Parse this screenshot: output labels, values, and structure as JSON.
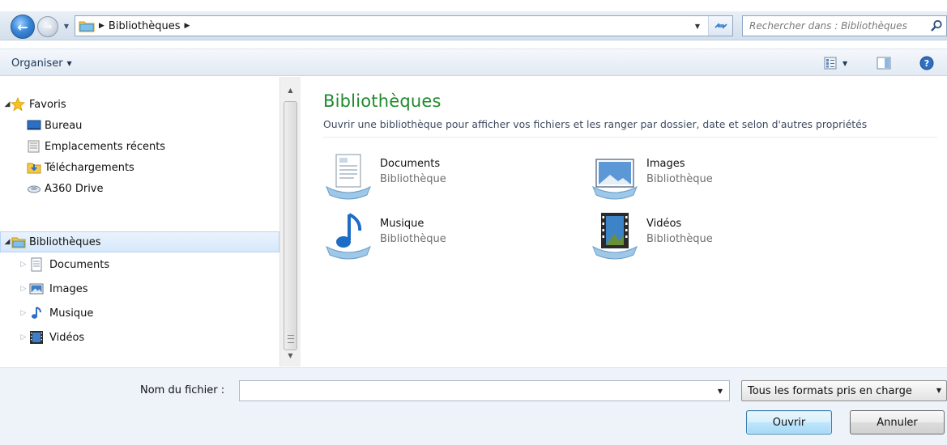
{
  "address_bar": {
    "breadcrumb": [
      "Bibliothèques"
    ],
    "search_placeholder": "Rechercher dans : Bibliothèques"
  },
  "toolbar": {
    "organize_label": "Organiser"
  },
  "nav_tree": {
    "favorites": {
      "label": "Favoris",
      "items": [
        {
          "label": "Bureau",
          "icon": "desktop-icon"
        },
        {
          "label": "Emplacements récents",
          "icon": "recent-places-icon"
        },
        {
          "label": "Téléchargements",
          "icon": "downloads-icon"
        },
        {
          "label": "A360 Drive",
          "icon": "cloud-drive-icon"
        }
      ]
    },
    "libraries": {
      "label": "Bibliothèques",
      "items": [
        {
          "label": "Documents",
          "icon": "documents-icon"
        },
        {
          "label": "Images",
          "icon": "images-icon"
        },
        {
          "label": "Musique",
          "icon": "music-icon"
        },
        {
          "label": "Vidéos",
          "icon": "videos-icon"
        }
      ]
    }
  },
  "content": {
    "title": "Bibliothèques",
    "description": "Ouvrir une bibliothèque pour afficher vos fichiers et les ranger par dossier, date et selon d'autres propriétés",
    "libraries": [
      {
        "name": "Documents",
        "kind": "Bibliothèque",
        "icon": "documents-library-icon"
      },
      {
        "name": "Images",
        "kind": "Bibliothèque",
        "icon": "images-library-icon"
      },
      {
        "name": "Musique",
        "kind": "Bibliothèque",
        "icon": "music-library-icon"
      },
      {
        "name": "Vidéos",
        "kind": "Bibliothèque",
        "icon": "videos-library-icon"
      }
    ]
  },
  "footer": {
    "filename_label": "Nom du fichier :",
    "filename_value": "",
    "filetype_selected": "Tous les formats pris en charge",
    "open_label": "Ouvrir",
    "cancel_label": "Annuler"
  },
  "colors": {
    "title_green": "#1e8a2c",
    "accent_blue": "#3c7fb1",
    "toolbar_text": "#1e395b"
  }
}
